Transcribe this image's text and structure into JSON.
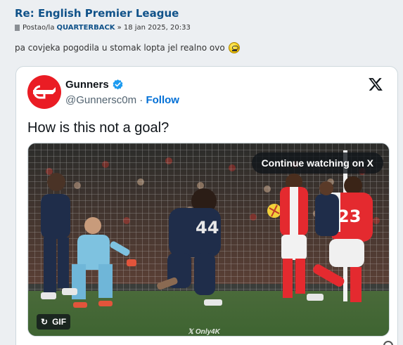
{
  "post": {
    "title": "Re: English Premier League",
    "meta_prefix": "Postao/la",
    "author": "QUARTERBACK",
    "meta_suffix": "» 18 jan 2025, 20:33",
    "body": "pa covjeka pogodila u stomak lopta jel realno ovo",
    "smiley_icon": "confused-smiley-icon"
  },
  "tweet": {
    "account_name": "Gunners",
    "handle": "@Gunnersc0m",
    "separator": "·",
    "follow_label": "Follow",
    "text": "How is this not a goal?",
    "verified_icon": "verified-badge-icon",
    "brand_icon": "x-logo-icon",
    "media": {
      "continue_label": "Continue watching on X",
      "gif_label": "GIF",
      "watermark": "𝕏 Only4K"
    }
  },
  "colors": {
    "link": "#105289",
    "follow": "#006fd6",
    "verified": "#1d9bf0",
    "avatar": "#ea1c24",
    "post_bg": "#eceff2"
  }
}
